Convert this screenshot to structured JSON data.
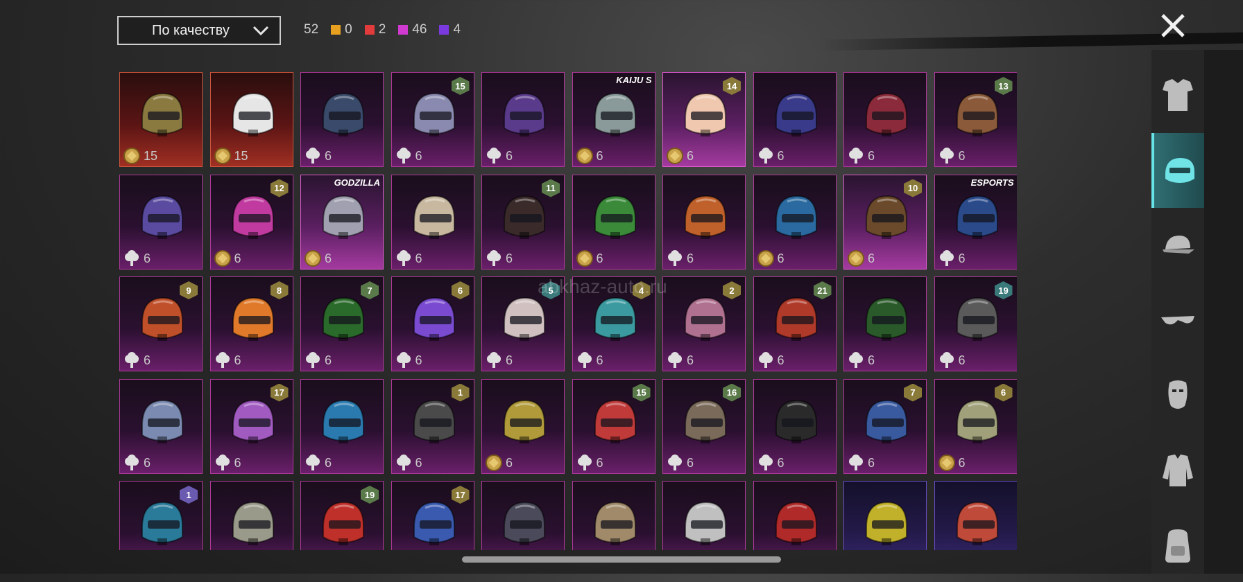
{
  "sort": {
    "label": "По качеству"
  },
  "counts": {
    "total": "52",
    "items": [
      {
        "value": "0",
        "color": "#e8a020"
      },
      {
        "value": "2",
        "color": "#e23b3b"
      },
      {
        "value": "46",
        "color": "#d03ad0"
      },
      {
        "value": "4",
        "color": "#7a3ae0"
      }
    ]
  },
  "watermark": "abkhaz-auto.ru",
  "nav": [
    "outfit-icon",
    "helmet-icon",
    "cap-icon",
    "glasses-icon",
    "mask-icon",
    "jacket-icon",
    "backpack-icon"
  ],
  "active_nav": 1,
  "items": [
    {
      "tier": "red",
      "art": "#8a7a40",
      "sub": "coin",
      "amount": "15"
    },
    {
      "tier": "red",
      "art": "#e6e6e6",
      "sub": "coin",
      "amount": "15"
    },
    {
      "art": "#3a4a6a",
      "sub": "tree",
      "amount": "6"
    },
    {
      "art": "#8a8ab0",
      "sub": "tree",
      "amount": "6",
      "level": "15",
      "lc": "g"
    },
    {
      "art": "#5a3a8a",
      "sub": "tree",
      "amount": "6"
    },
    {
      "art": "#8a9a9a",
      "sub": "coin",
      "amount": "6",
      "brand": "KAIJU S"
    },
    {
      "sel": true,
      "art": "#f0c8b0",
      "sub": "coin",
      "amount": "6",
      "level": "14"
    },
    {
      "art": "#3a3a8a",
      "sub": "tree",
      "amount": "6"
    },
    {
      "art": "#8a2a3a",
      "sub": "tree",
      "amount": "6"
    },
    {
      "art": "#8a5a3a",
      "sub": "tree",
      "amount": "6",
      "level": "13",
      "lc": "g"
    },
    {
      "art": "#5a4aa0",
      "sub": "tree",
      "amount": "6"
    },
    {
      "art": "#c03aa0",
      "sub": "coin",
      "amount": "6",
      "level": "12"
    },
    {
      "sel": true,
      "art": "#a0a0b0",
      "sub": "coin",
      "amount": "6",
      "brand": "GODZILLA"
    },
    {
      "art": "#c8b8a0",
      "sub": "tree",
      "amount": "6"
    },
    {
      "art": "#3a2a2a",
      "sub": "tree",
      "amount": "6",
      "level": "11",
      "lc": "g"
    },
    {
      "art": "#3a8a3a",
      "sub": "coin",
      "amount": "6"
    },
    {
      "art": "#c0602a",
      "sub": "tree",
      "amount": "6"
    },
    {
      "art": "#2a6aa0",
      "sub": "coin",
      "amount": "6"
    },
    {
      "sel": true,
      "art": "#6a4a2a",
      "sub": "coin",
      "amount": "6",
      "level": "10"
    },
    {
      "art": "#2a4a8a",
      "sub": "tree",
      "amount": "6",
      "brand": "ESPORTS"
    },
    {
      "art": "#c0502a",
      "sub": "tree",
      "amount": "6",
      "level": "9"
    },
    {
      "art": "#e07a2a",
      "sub": "tree",
      "amount": "6",
      "level": "8"
    },
    {
      "art": "#2a6a2a",
      "sub": "tree",
      "amount": "6",
      "level": "7",
      "lc": "g"
    },
    {
      "art": "#7a4ad0",
      "sub": "tree",
      "amount": "6",
      "level": "6"
    },
    {
      "art": "#d0c0c0",
      "sub": "tree",
      "amount": "6",
      "level": "5",
      "lc": "t"
    },
    {
      "art": "#3a9aa0",
      "sub": "tree",
      "amount": "6",
      "level": "4"
    },
    {
      "art": "#b07090",
      "sub": "tree",
      "amount": "6",
      "level": "2"
    },
    {
      "art": "#b03a2a",
      "sub": "tree",
      "amount": "6",
      "level": "21",
      "lc": "g"
    },
    {
      "art": "#2a5a2a",
      "sub": "tree",
      "amount": "6"
    },
    {
      "art": "#5a5a5a",
      "sub": "tree",
      "amount": "6",
      "level": "19",
      "lc": "t"
    },
    {
      "art": "#7a8ab0",
      "sub": "tree",
      "amount": "6"
    },
    {
      "art": "#a05ac0",
      "sub": "tree",
      "amount": "6",
      "level": "17"
    },
    {
      "art": "#2a7ab0",
      "sub": "tree",
      "amount": "6"
    },
    {
      "art": "#4a4a4a",
      "sub": "tree",
      "amount": "6",
      "level": "1"
    },
    {
      "art": "#b09a3a",
      "sub": "coin",
      "amount": "6"
    },
    {
      "art": "#c03a3a",
      "sub": "tree",
      "amount": "6",
      "level": "15",
      "lc": "g"
    },
    {
      "art": "#7a6a5a",
      "sub": "tree",
      "amount": "6",
      "level": "16",
      "lc": "g"
    },
    {
      "art": "#2a2a2a",
      "sub": "tree",
      "amount": "6"
    },
    {
      "art": "#3a5aa0",
      "sub": "tree",
      "amount": "6",
      "level": "7"
    },
    {
      "art": "#a0a07a",
      "sub": "coin",
      "amount": "6",
      "level": "6"
    },
    {
      "art": "#2a7a9a",
      "level": "1",
      "lc": "p"
    },
    {
      "art": "#9a9a8a"
    },
    {
      "art": "#c0302a",
      "level": "19",
      "lc": "g"
    },
    {
      "art": "#3a5ab0",
      "level": "17"
    },
    {
      "art": "#4a4a5a"
    },
    {
      "art": "#a08a6a"
    },
    {
      "art": "#c0c0c0"
    },
    {
      "art": "#b02a2a"
    },
    {
      "tier": "purple",
      "art": "#c0b02a"
    },
    {
      "tier": "purple",
      "art": "#c04a3a"
    }
  ]
}
